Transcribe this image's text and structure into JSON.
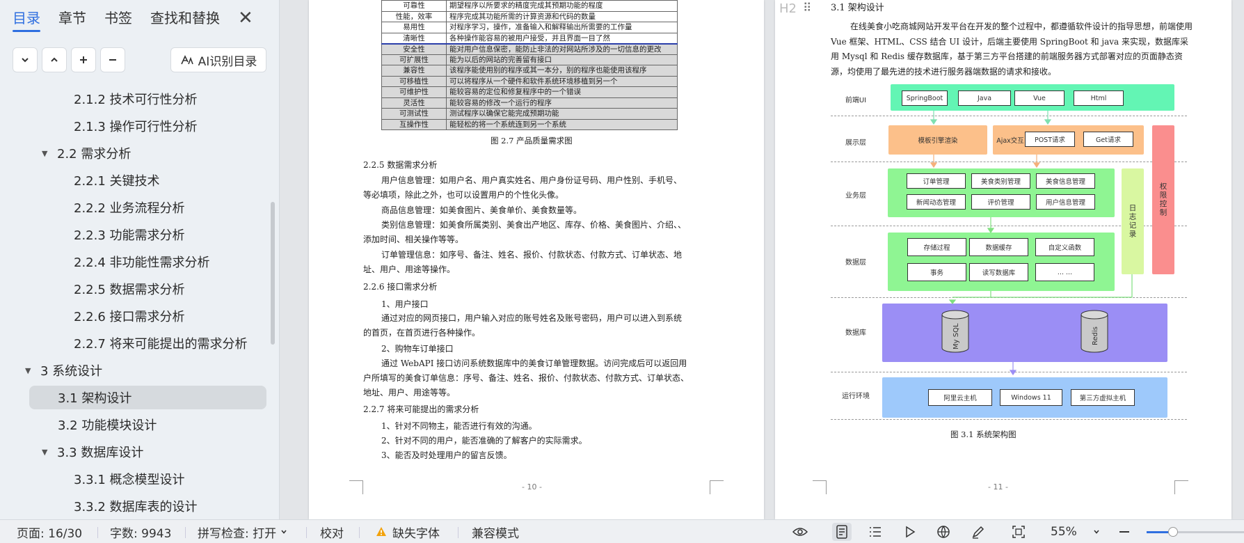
{
  "sidebar": {
    "tabs": [
      {
        "label": "目录",
        "active": true
      },
      {
        "label": "章节"
      },
      {
        "label": "书签"
      },
      {
        "label": "查找和替换"
      }
    ],
    "ai_button": "AI识别目录",
    "toc": [
      {
        "label": "2.1.2  技术可行性分析",
        "level": 3
      },
      {
        "label": "2.1.3  操作可行性分析",
        "level": 3
      },
      {
        "label": "2.2  需求分析",
        "level": 2,
        "expanded": true
      },
      {
        "label": "2.2.1  关键技术",
        "level": 3
      },
      {
        "label": "2.2.2  业务流程分析",
        "level": 3
      },
      {
        "label": "2.2.3  功能需求分析",
        "level": 3
      },
      {
        "label": "2.2.4  非功能性需求分析",
        "level": 3
      },
      {
        "label": "2.2.5  数据需求分析",
        "level": 3
      },
      {
        "label": "2.2.6  接口需求分析",
        "level": 3
      },
      {
        "label": "2.2.7  将来可能提出的需求分析",
        "level": 3
      },
      {
        "label": "3  系统设计",
        "level": 1,
        "expanded": true
      },
      {
        "label": "3.1  架构设计",
        "level": 2,
        "selected": true
      },
      {
        "label": "3.2  功能模块设计",
        "level": 2
      },
      {
        "label": "3.3  数据库设计",
        "level": 2,
        "expanded": true
      },
      {
        "label": "3.3.1  概念模型设计",
        "level": 3
      },
      {
        "label": "3.3.2  数据库表的设计",
        "level": 3
      }
    ]
  },
  "left_page": {
    "quality_table": [
      [
        "可靠性",
        "期望程序以所要求的精度完成其预期功能的程度"
      ],
      [
        "性能，效率",
        "程序完成其功能所需的计算资源和代码的数量"
      ],
      [
        "易用性",
        "对程序学习，操作，准备输入和解释输出所需要的工作量"
      ],
      [
        "清晰性",
        "各种操作能容易的被用户接受，并且界面一目了然"
      ],
      [
        "安全性",
        "能对用户信息保密，能防止非法的对网站所涉及的一切信息的更改"
      ],
      [
        "可扩展性",
        "能为以后的网站的完善留有接口"
      ],
      [
        "兼容性",
        "该程序能使用别的程序或其一本分，别的程序也能使用该程序"
      ],
      [
        "可移植性",
        "可以将程序从一个硬件和软件系统环境移植到另一个"
      ],
      [
        "可维护性",
        "能较容易的定位和修复程序中的一个错误"
      ],
      [
        "灵活性",
        "能较容易的修改一个运行的程序"
      ],
      [
        "可测试性",
        "测试程序以确保它能完成预期功能"
      ],
      [
        "互操作性",
        "能轻松的将一个系统连到另一个系统"
      ]
    ],
    "table_caption": "图 2.7  产品质量需求图",
    "h_225": "2.2.5  数据需求分析",
    "p1a": "用户信息管理：如用户名、用户真实姓名、用户身份证号码、用户性别、手机号、",
    "p1b": "等必填项，除此之外，也可以设置用户的个性化头像。",
    "p2": "商品信息管理：如美食图片、美食单价、美食数量等。",
    "p3a": "类别信息管理：如美食所属类别、美食出产地区、库存、价格、美食图片、介绍、、",
    "p3b": "添加时间、相关操作等等。",
    "p4a": "订单管理信息：如序号、备注、姓名、报价、付款状态、付款方式、订单状态、地",
    "p4b": "址、用户、用途等操作。",
    "h_226": "2.2.6  接口需求分析",
    "i1": "1、用户接口",
    "i1a": "通过对应的网页接口，用户输入对应的账号姓名及账号密码，用户可以进入到系统",
    "i1b": "的首页，在首页进行各种操作。",
    "i2": "2、购物车订单接口",
    "i2a": "通过 WebAPI 接口访问系统数据库中的美食订单管理数据。访问完成后可以返回用",
    "i2b": "户所填写的美食订单信息：序号、备注、姓名、报价、付款状态、付款方式、订单状态、",
    "i2c": "地址、用户、用途等等。",
    "h_227": "2.2.7  将来可能提出的需求分析",
    "f1": "1、针对不同物主，能否进行有效的沟通。",
    "f2": "2、针对不同的用户，能否准确的了解客户的实际需求。",
    "f3": "3、能否及时处理用户的留言反馈。",
    "page_number": "- 10 -"
  },
  "right_page": {
    "h2_marker": "H2",
    "heading": "3.1  架构设计",
    "intro": "在线美食小吃商城网站开发平台在开发的整个过程中，都遵循软件设计的指导思想，前端使用 Vue 框架、HTML、CSS 结合 UI 设计，后端主要使用 SpringBoot 和 java 来实现，数据库采用 Mysql 和 Redis 缓存数据库，基于第三方平台搭建的前端服务器方式部署对应的页面静态资源，均使用了最先进的技术进行服务器端数据的请求和接收。",
    "diagram": {
      "layers": [
        "前端UI",
        "展示层",
        "业务层",
        "数据层",
        "数据库",
        "运行环境"
      ],
      "frontend": [
        "SpringBoot",
        "Java",
        "Vue",
        "Html"
      ],
      "display_left": "模板引擎渲染",
      "display_right_label": "Ajax交互",
      "display_right": [
        "POST请求",
        "Get请求"
      ],
      "business": [
        "订单管理",
        "美食类别管理",
        "美食信息管理",
        "新闻动态管理",
        "评价管理",
        "用户信息管理"
      ],
      "data": [
        "存储过程",
        "数据缓存",
        "自定义函数",
        "事务",
        "读写数据库",
        "... ..."
      ],
      "databases": [
        "My SQL",
        "Redis"
      ],
      "runtime": [
        "阿里云主机",
        "Windows 11",
        "第三方虚拟主机"
      ],
      "log_label": "日志记录",
      "auth_label": "权限控制"
    },
    "caption": "图 3.1  系统架构图",
    "page_number": "- 11 -"
  },
  "statusbar": {
    "page": "页面: 16/30",
    "words": "字数: 9943",
    "spell": "拼写检查: 打开",
    "proof": "校对",
    "missing_font": "缺失字体",
    "compat": "兼容模式",
    "zoom": "55%",
    "zoom_level": 0.27
  }
}
